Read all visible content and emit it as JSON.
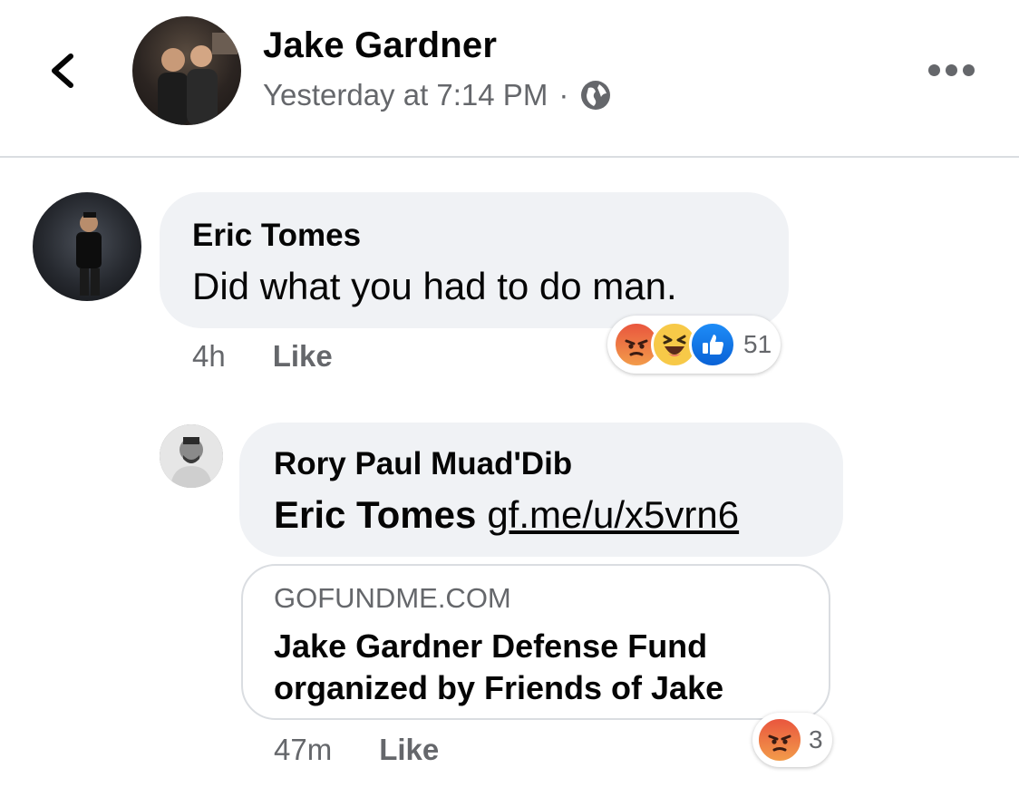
{
  "post": {
    "author": "Jake Gardner",
    "timestamp": "Yesterday at 7:14 PM",
    "separator": "·",
    "audience_icon": "globe-icon"
  },
  "comments": [
    {
      "name": "Eric Tomes",
      "text": "Did what you had to do man.",
      "time": "4h",
      "like_label": "Like",
      "reactions": [
        "angry",
        "haha",
        "like"
      ],
      "reaction_count": "51"
    },
    {
      "name": "Rory Paul Muad'Dib",
      "mention": "Eric Tomes",
      "link_text": "gf.me/u/x5vrn6",
      "card": {
        "domain": "GOFUNDME.COM",
        "title": "Jake Gardner Defense Fund organized by Friends of Jake"
      },
      "time": "47m",
      "like_label": "Like",
      "reactions": [
        "angry"
      ],
      "reaction_count": "3"
    }
  ],
  "colors": {
    "bubble": "#f0f2f5",
    "secondary_text": "#65676b",
    "like_blue": "#1877f2",
    "angry_orange": "#e9563e",
    "haha_yellow": "#f7c948"
  }
}
